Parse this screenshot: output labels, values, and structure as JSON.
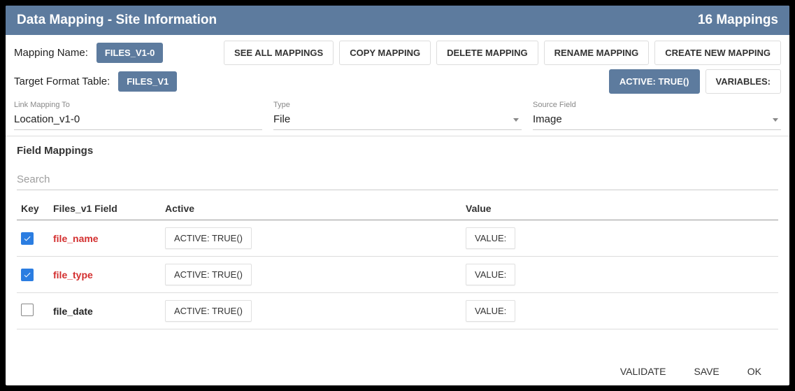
{
  "header": {
    "title": "Data Mapping - Site Information",
    "count": "16 Mappings"
  },
  "mapping": {
    "name_label": "Mapping Name:",
    "name_chip": "FILES_V1-0",
    "target_label": "Target Format Table:",
    "target_chip": "FILES_V1"
  },
  "buttons": {
    "see_all": "SEE ALL MAPPINGS",
    "copy": "COPY MAPPING",
    "delete": "DELETE MAPPING",
    "rename": "RENAME MAPPING",
    "create": "CREATE NEW MAPPING",
    "active": "ACTIVE: TRUE()",
    "variables": "VARIABLES:"
  },
  "fields": {
    "link_label": "Link Mapping To",
    "link_value": "Location_v1-0",
    "type_label": "Type",
    "type_value": "File",
    "source_label": "Source Field",
    "source_value": "Image"
  },
  "section": {
    "title": "Field Mappings",
    "search_placeholder": "Search"
  },
  "columns": {
    "key": "Key",
    "field": "Files_v1 Field",
    "active": "Active",
    "value": "Value"
  },
  "rows": [
    {
      "checked": true,
      "required": true,
      "name": "file_name",
      "active": "ACTIVE: TRUE()",
      "value": "VALUE:"
    },
    {
      "checked": true,
      "required": true,
      "name": "file_type",
      "active": "ACTIVE: TRUE()",
      "value": "VALUE:"
    },
    {
      "checked": false,
      "required": false,
      "name": "file_date",
      "active": "ACTIVE: TRUE()",
      "value": "VALUE:"
    }
  ],
  "footer": {
    "validate": "VALIDATE",
    "save": "SAVE",
    "ok": "OK"
  }
}
